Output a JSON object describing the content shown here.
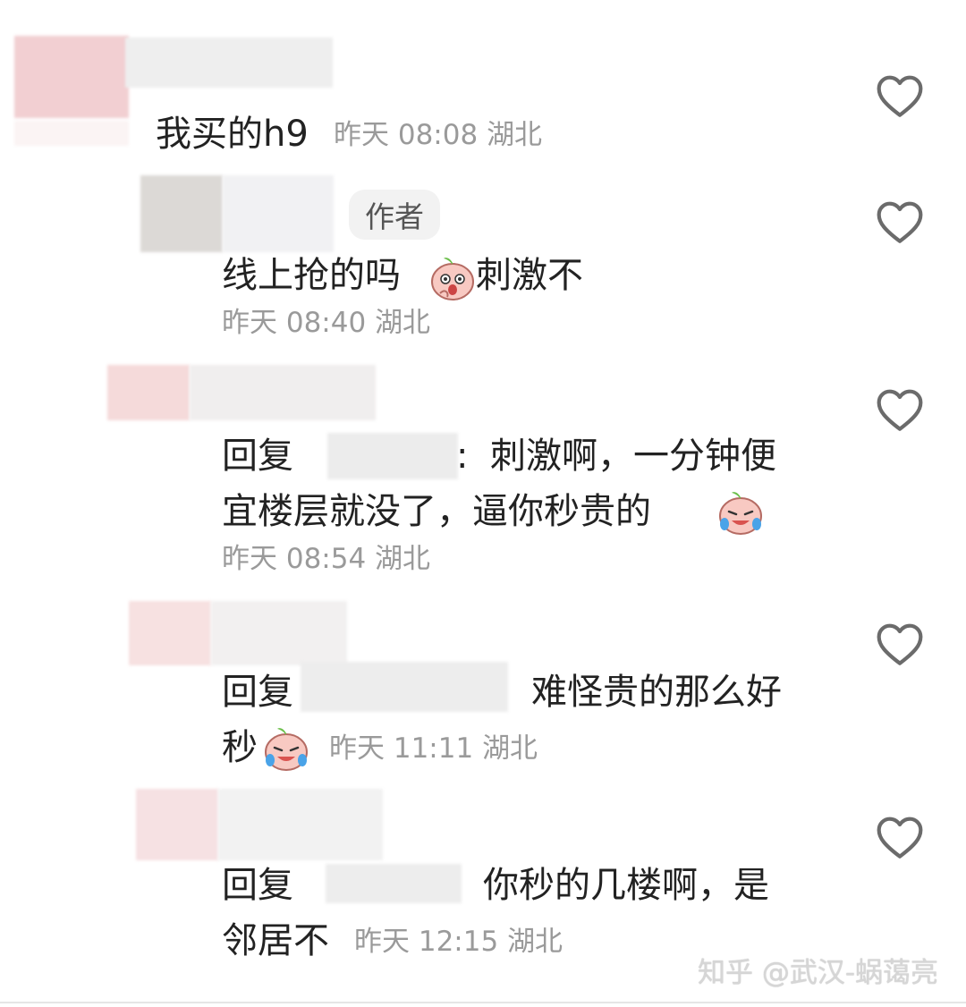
{
  "icons": {
    "like": "heart-outline-icon",
    "emoji": "peach-face-emoji"
  },
  "comments": [
    {
      "text": "我买的h9",
      "time": "昨天 08:08",
      "location": "湖北"
    },
    {
      "badge": "作者",
      "text": "线上抢的吗",
      "text_after_emoji": "刺激不",
      "time": "昨天 08:40",
      "location": "湖北"
    },
    {
      "reply_prefix": "回复",
      "colon": ":",
      "line1": "刺激啊，一分钟便",
      "line2": "宜楼层就没了，逼你秒贵的",
      "time": "昨天 08:54",
      "location": "湖北"
    },
    {
      "reply_prefix": "回复",
      "line1": "难怪贵的那么好",
      "line2": "秒",
      "time": "昨天 11:11",
      "location": "湖北"
    },
    {
      "reply_prefix": "回复",
      "line1": "你秒的几楼啊，是",
      "line2": "邻居不",
      "time": "昨天 12:15",
      "location": "湖北"
    }
  ],
  "watermark": "知乎 @武汉-蜗蔼亮",
  "colors": {
    "text": "#222222",
    "meta": "#9a9a9a",
    "badge_bg": "#f2f2f2",
    "icon": "#6b6b6b"
  }
}
